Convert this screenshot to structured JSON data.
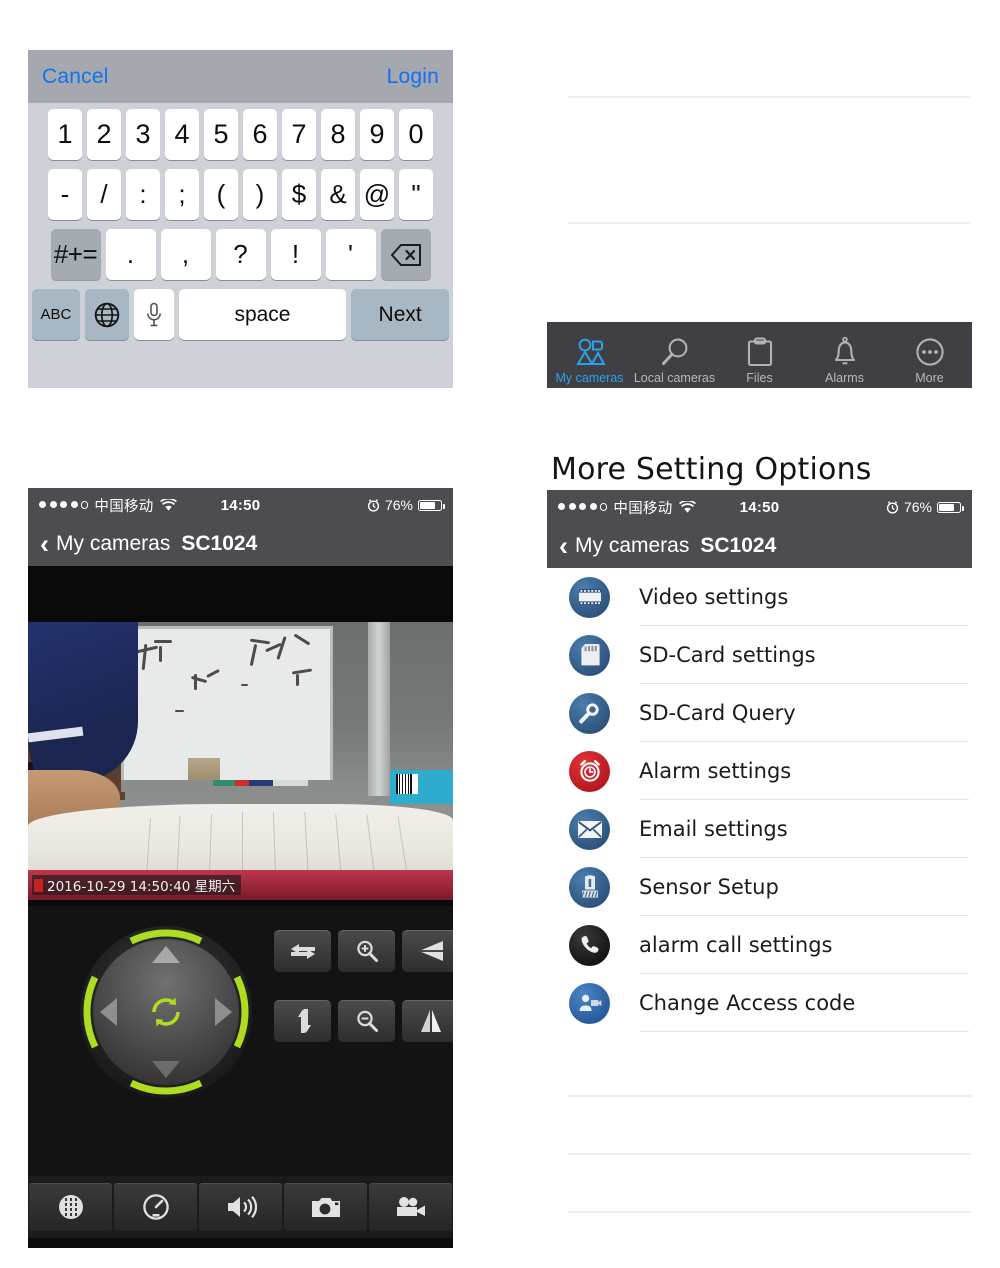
{
  "keyboard_panel": {
    "toolbar": {
      "cancel_label": "Cancel",
      "login_label": "Login"
    },
    "row_numbers": [
      "1",
      "2",
      "3",
      "4",
      "5",
      "6",
      "7",
      "8",
      "9",
      "0"
    ],
    "row_symbols": [
      "-",
      "/",
      ":",
      ";",
      "(",
      ")",
      "$",
      "&",
      "@",
      "\""
    ],
    "row_punct": {
      "symbol_key": "#+=",
      "keys": [
        ".",
        ",",
        "?",
        "!",
        "'"
      ],
      "delete_icon": "backspace-icon"
    },
    "row_bottom": {
      "abc_label": "ABC",
      "globe_icon": "globe-icon",
      "mic_icon": "microphone-icon",
      "space_label": "space",
      "next_label": "Next"
    }
  },
  "tabbar": {
    "items": [
      {
        "label": "My cameras",
        "icon": "my-cameras-icon",
        "active": true
      },
      {
        "label": "Local cameras",
        "icon": "magnifier-icon",
        "active": false
      },
      {
        "label": "Files",
        "icon": "clipboard-icon",
        "active": false
      },
      {
        "label": "Alarms",
        "icon": "bell-icon",
        "active": false
      },
      {
        "label": "More",
        "icon": "more-ellipsis-icon",
        "active": false
      }
    ],
    "active_color": "#2ba3ea",
    "inactive_color": "#b6b8bb",
    "background": "#3f3f44"
  },
  "heading": {
    "text": "More Setting Options"
  },
  "status_bar": {
    "signal_dots_filled": 4,
    "signal_dots_total": 5,
    "carrier": "中国移动",
    "wifi_icon": "wifi-icon",
    "time": "14:50",
    "alarm_icon": "alarm-clock-icon",
    "battery_percent": "76%",
    "battery_level": 76,
    "background": "#4c4c51"
  },
  "nav_bar": {
    "back_icon": "chevron-left-icon",
    "back_label": "My cameras",
    "title": "SC1024"
  },
  "live_view": {
    "timestamp_overlay": "2016-10-29 14:50:40 星期六",
    "ptz": {
      "up_icon": "arrow-up-icon",
      "down_icon": "arrow-down-icon",
      "left_icon": "arrow-left-icon",
      "right_icon": "arrow-right-icon",
      "center_icon": "rotate-refresh-icon",
      "ring_color": "#b6e22b"
    },
    "control_buttons": [
      {
        "icon": "horizontal-pan-icon",
        "name": "horizontal-cruise-button"
      },
      {
        "icon": "zoom-in-icon",
        "name": "zoom-in-button"
      },
      {
        "icon": "flip-vertical-icon",
        "name": "mirror-vertical-button"
      },
      {
        "icon": "vertical-pan-icon",
        "name": "vertical-cruise-button"
      },
      {
        "icon": "zoom-out-icon",
        "name": "zoom-out-button"
      },
      {
        "icon": "flip-horizontal-icon",
        "name": "mirror-horizontal-button"
      }
    ],
    "bottom_buttons": [
      {
        "icon": "equalizer-icon",
        "name": "image-settings-button"
      },
      {
        "icon": "speedometer-icon",
        "name": "stream-quality-button"
      },
      {
        "icon": "speaker-icon",
        "name": "audio-button"
      },
      {
        "icon": "camera-icon",
        "name": "snapshot-button"
      },
      {
        "icon": "video-cam-icon",
        "name": "record-button"
      }
    ]
  },
  "settings_list": {
    "items": [
      {
        "label": "Video settings",
        "icon": "film-strip-icon",
        "color": "#2f5f91"
      },
      {
        "label": "SD-Card settings",
        "icon": "sd-card-icon",
        "color": "#2f5f91"
      },
      {
        "label": "SD-Card Query",
        "icon": "magnifier-icon",
        "color": "#2f5f91"
      },
      {
        "label": "Alarm settings",
        "icon": "alarm-clock-icon",
        "color": "#c4161c"
      },
      {
        "label": "Email settings",
        "icon": "envelope-icon",
        "color": "#2f5f91"
      },
      {
        "label": "Sensor Setup",
        "icon": "sensor-icon",
        "color": "#2f5f91"
      },
      {
        "label": "alarm call settings",
        "icon": "phone-icon",
        "color": "#141414"
      },
      {
        "label": "Change Access code",
        "icon": "camera-user-icon",
        "color": "#2a63ad"
      }
    ]
  }
}
